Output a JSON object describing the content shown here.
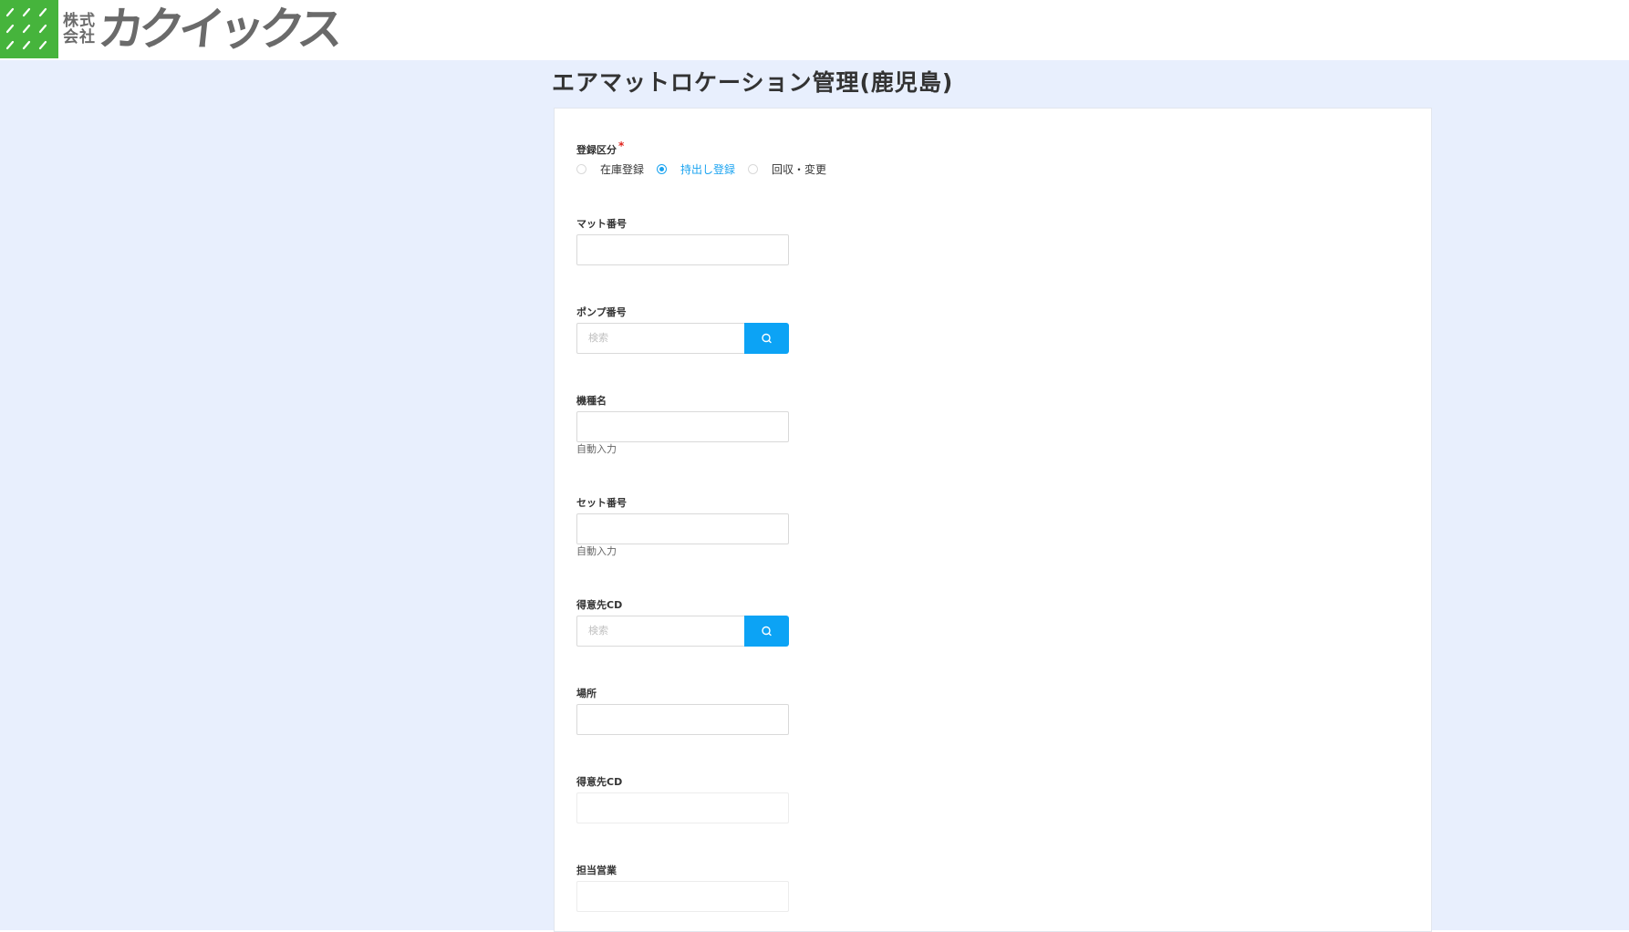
{
  "header": {
    "logo_small_line1": "株式",
    "logo_small_line2": "会社",
    "logo_text": "カクイックス"
  },
  "page": {
    "title": "エアマットロケーション管理(鹿児島)"
  },
  "form": {
    "registration_type": {
      "label": "登録区分",
      "required_mark": "*",
      "options": [
        "在庫登録",
        "持出し登録",
        "回収・変更"
      ],
      "selected": "持出し登録"
    },
    "mat_number": {
      "label": "マット番号",
      "value": ""
    },
    "pump_number": {
      "label": "ポンプ番号",
      "placeholder": "検索"
    },
    "model_name": {
      "label": "機種名",
      "value": "",
      "help": "自動入力"
    },
    "set_number": {
      "label": "セット番号",
      "value": "",
      "help": "自動入力"
    },
    "customer_cd": {
      "label": "得意先CD",
      "placeholder": "検索"
    },
    "location": {
      "label": "場所",
      "value": ""
    },
    "customer_cd_2": {
      "label": "得意先CD",
      "value": ""
    },
    "sales_rep": {
      "label": "担当営業",
      "value": ""
    }
  },
  "colors": {
    "brand_green": "#46b43c",
    "accent_blue": "#0ca3f5",
    "page_background": "#e8effd",
    "required_red": "#e0241d"
  },
  "icons": {
    "search_button_icon": "search-icon",
    "logo_icon": "logo-mark-icon"
  }
}
